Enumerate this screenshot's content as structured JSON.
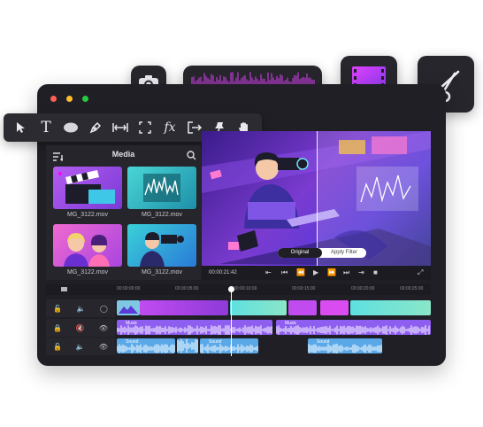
{
  "media_panel": {
    "title": "Media",
    "items": [
      {
        "name": "MG_3122.mov"
      },
      {
        "name": "MG_3122.mov"
      },
      {
        "name": "MG_3122.mov"
      },
      {
        "name": "MG_3122.mov"
      }
    ]
  },
  "preview": {
    "timecode": "00:00:21:42",
    "compare_left": "Original",
    "compare_right": "Apply Filter"
  },
  "ruler": {
    "ticks": [
      "00:00:00:00",
      "00:00:05:00",
      "00:00:10:00",
      "00:00:15:00",
      "00:00:20:00",
      "00:00:25:00",
      "00:00:30:00"
    ]
  },
  "tracks": {
    "music_label": "Music",
    "sound_label": "Sound"
  },
  "icons": {
    "toolbar": [
      "cursor-icon",
      "text-icon",
      "ellipse-icon",
      "pen-icon",
      "split-icon",
      "crop-icon",
      "fx-icon",
      "export-icon",
      "pin-icon",
      "hand-icon"
    ],
    "floating": [
      "camera-icon",
      "waveform-icon",
      "film-icon",
      "scissors-icon"
    ]
  },
  "colors": {
    "window_bg": "#1f1f25",
    "accent_purple": "#9b5cf5",
    "accent_magenta": "#d946ef",
    "accent_teal": "#2dd4bf",
    "audio_blue": "#5aa8e8"
  }
}
